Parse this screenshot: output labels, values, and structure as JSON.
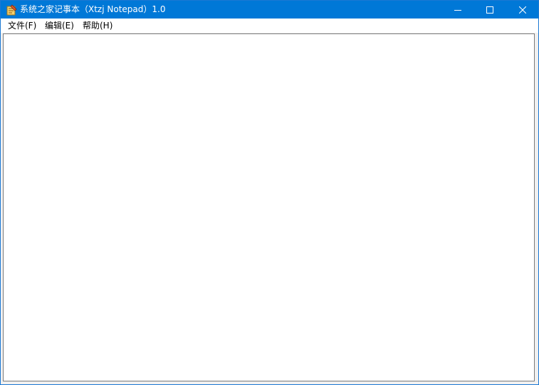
{
  "window": {
    "title": "系统之家记事本（Xtzj Notepad）1.0",
    "accent_color": "#0078d7",
    "icon": "notepad-app-icon"
  },
  "caption_buttons": {
    "minimize_icon": "minimize-icon",
    "maximize_icon": "maximize-icon",
    "close_icon": "close-icon"
  },
  "menubar": {
    "items": [
      {
        "label": "文件(F)"
      },
      {
        "label": "编辑(E)"
      },
      {
        "label": "帮助(H)"
      }
    ]
  },
  "editor": {
    "value": ""
  }
}
